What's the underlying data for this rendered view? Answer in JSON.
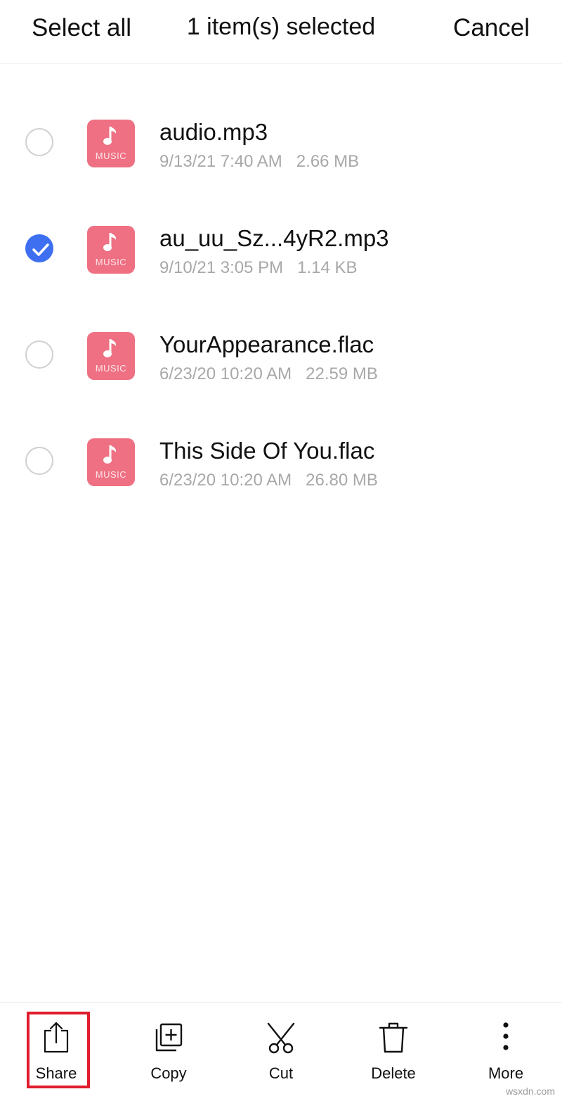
{
  "header": {
    "select_all_label": "Select all",
    "title": "1 item(s) selected",
    "cancel_label": "Cancel"
  },
  "files": [
    {
      "name": "audio.mp3",
      "date": "9/13/21 7:40 AM",
      "size": "2.66 MB",
      "selected": false,
      "icon_label": "MUSIC"
    },
    {
      "name": "au_uu_Sz...4yR2.mp3",
      "date": "9/10/21 3:05 PM",
      "size": "1.14 KB",
      "selected": true,
      "icon_label": "MUSIC"
    },
    {
      "name": "YourAppearance.flac",
      "date": "6/23/20 10:20 AM",
      "size": "22.59 MB",
      "selected": false,
      "icon_label": "MUSIC"
    },
    {
      "name": "This Side Of You.flac",
      "date": "6/23/20 10:20 AM",
      "size": "26.80 MB",
      "selected": false,
      "icon_label": "MUSIC"
    }
  ],
  "toolbar": {
    "share_label": "Share",
    "copy_label": "Copy",
    "cut_label": "Cut",
    "delete_label": "Delete",
    "more_label": "More"
  },
  "watermark": "wsxdn.com",
  "colors": {
    "accent": "#3d6ff0",
    "music_icon": "#ee7082",
    "highlight": "#e01c2c",
    "meta_text": "#a8a8a8"
  },
  "icons": {
    "share": "share-icon",
    "copy": "copy-icon",
    "cut": "scissors-icon",
    "delete": "trash-icon",
    "more": "more-vertical-icon",
    "file": "music-note-icon",
    "check": "checkmark-icon"
  }
}
